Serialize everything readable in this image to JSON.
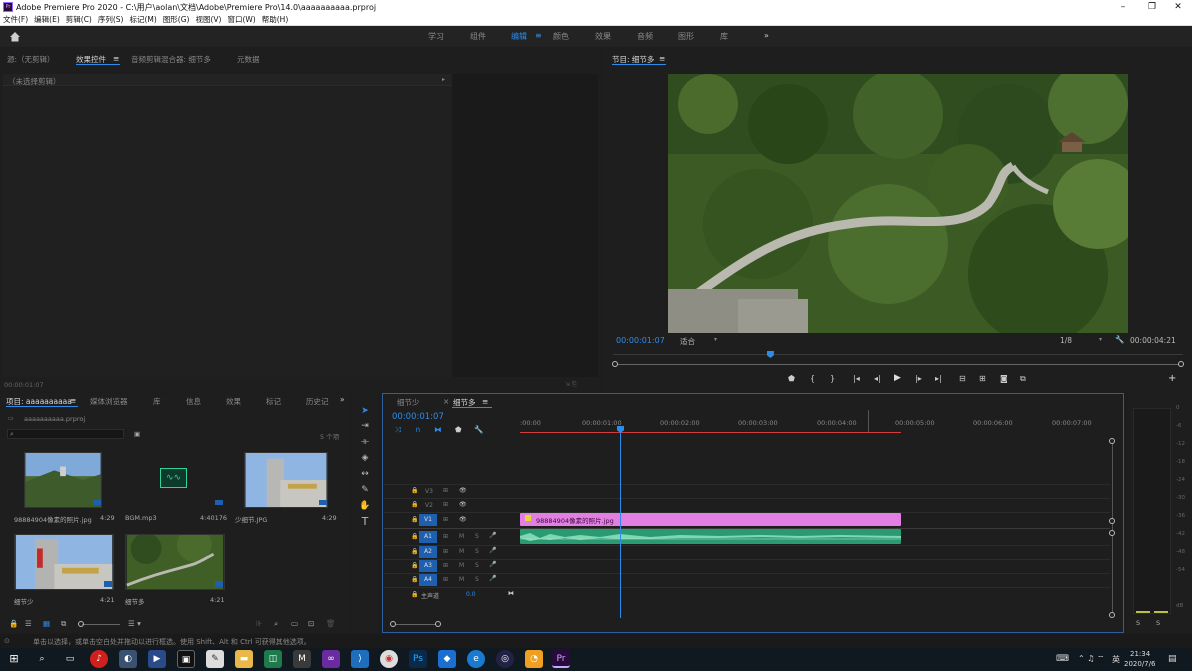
{
  "window": {
    "title": "Adobe Premiere Pro 2020 - C:\\用户\\aolan\\文档\\Adobe\\Premiere Pro\\14.0\\aaaaaaaaaa.prproj",
    "logo": "Pr"
  },
  "menu": [
    "文件(F)",
    "编辑(E)",
    "剪辑(C)",
    "序列(S)",
    "标记(M)",
    "图形(G)",
    "视图(V)",
    "窗口(W)",
    "帮助(H)"
  ],
  "workspaces": {
    "items": [
      "学习",
      "组件",
      "编辑",
      "颜色",
      "效果",
      "音频",
      "图形",
      "库"
    ],
    "active": "编辑",
    "more": "»"
  },
  "source_panel": {
    "tabs": [
      "源:（无剪辑）",
      "效果控件",
      "音频剪辑混合器: 细节多",
      "元数据"
    ],
    "no_clip": "（未选择剪辑）",
    "timecode": "00:00:01:07"
  },
  "program_monitor": {
    "title": "节目: 细节多",
    "timecode": "00:00:01:07",
    "fit": "适合",
    "resolution": "1/8",
    "duration": "00:00:04:21",
    "playhead_fraction": 0.27
  },
  "project_panel": {
    "tabs": [
      "项目: aaaaaaaaaa",
      "媒体浏览器",
      "库",
      "信息",
      "效果",
      "标记",
      "历史记"
    ],
    "file": "aaaaaaaaaa.prproj",
    "count": "5 个项",
    "items": [
      {
        "name": "98884904像素的照片.jpg",
        "duration": "4:29"
      },
      {
        "name": "BGM.mp3",
        "duration": "4:40176"
      },
      {
        "name": "少细节.JPG",
        "duration": "4:29"
      },
      {
        "name": "细节少",
        "duration": "4:21"
      },
      {
        "name": "细节多",
        "duration": "4:21"
      }
    ]
  },
  "timeline": {
    "tabs": [
      "细节少",
      "细节多"
    ],
    "active_tab": "细节多",
    "timecode": "00:00:01:07",
    "ruler": [
      ":00:00",
      "00:00:01:00",
      "00:00:02:00",
      "00:00:03:00",
      "00:00:04:00",
      "00:00:05:00",
      "00:00:06:00",
      "00:00:07:00"
    ],
    "video_tracks": [
      "V3",
      "V2",
      "V1"
    ],
    "audio_tracks": [
      "A1",
      "A2",
      "A3",
      "A4"
    ],
    "master": "主声道",
    "master_value": "0.0",
    "clip_video": "98884904像素的照片.jpg",
    "audio_letters": {
      "m": "M",
      "s": "S"
    }
  },
  "meter": {
    "labels": [
      "0",
      "-6",
      "-12",
      "-18",
      "-24",
      "-30",
      "-36",
      "-42",
      "-48",
      "-54",
      "dB"
    ],
    "solo": [
      "S",
      "S"
    ]
  },
  "status_bar": "单击以选择，或单击空白处并拖动以进行框选。使用 Shift、Alt 和 Ctrl 可获得其他选项。",
  "taskbar": {
    "time": "21:34",
    "date": "2020/7/6",
    "lang": "英"
  },
  "icons": [
    "home-icon",
    "search-icon",
    "folder-icon",
    "selection-tool-icon",
    "razor-tool-icon",
    "pen-tool-icon",
    "hand-tool-icon",
    "type-tool-icon",
    "play-icon",
    "wrench-icon",
    "eye-icon",
    "lock-icon",
    "mic-icon",
    "windows-start-icon"
  ],
  "colors": {
    "accent": "#2d8ceb",
    "video_clip": "#e37fe3",
    "audio_clip": "#2a9a73"
  }
}
